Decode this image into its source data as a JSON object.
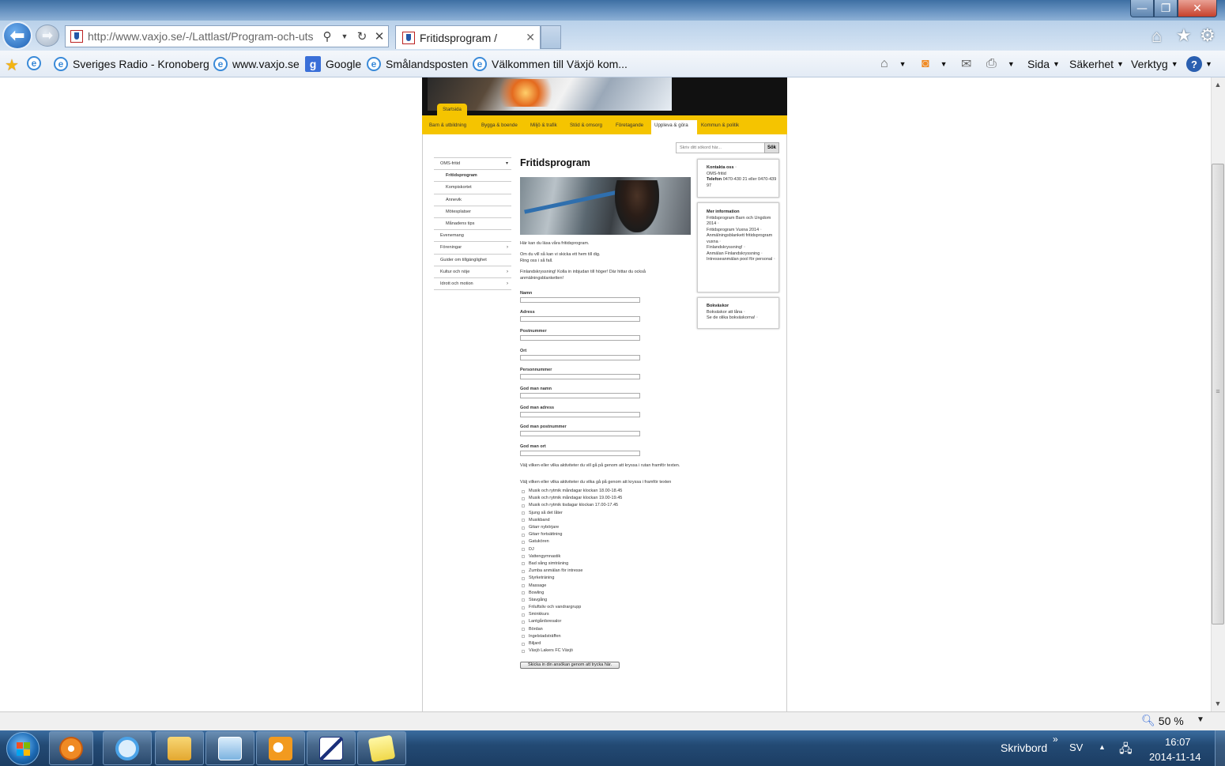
{
  "browser": {
    "window_controls": {
      "minimize": "—",
      "maximize": "❐",
      "close": "✕"
    },
    "address": "http://www.vaxjo.se/-/Lattlast/Program-och-uts",
    "tab_title": "Fritidsprogram /",
    "tab_close": "✕",
    "favorites": [
      {
        "label": "Sveriges Radio - Kronoberg",
        "icon": "ie-icon"
      },
      {
        "label": "www.vaxjo.se",
        "icon": "ie-icon"
      },
      {
        "label": "Google",
        "icon": "google-icon"
      },
      {
        "label": "Smålandsposten",
        "icon": "ie-icon"
      },
      {
        "label": "Välkommen till Växjö kom...",
        "icon": "ie-icon"
      }
    ],
    "google_letter": "g",
    "commands": {
      "page": "Sida",
      "safety": "Säkerhet",
      "tools": "Verktyg",
      "help": "?"
    },
    "zoom": "50 %"
  },
  "site": {
    "start_tab": "Startsida",
    "topnav": [
      "Barn & utbildning",
      "Bygga & boende",
      "Miljö & trafik",
      "Stöd & omsorg",
      "Företagande",
      "Uppleva & göra",
      "Kommun & politik"
    ],
    "search_placeholder": "Skriv ditt sökord här...",
    "search_button": "Sök",
    "leftmenu": [
      {
        "label": "OMS-fritid",
        "level": 0,
        "arrow": "▾"
      },
      {
        "label": "Fritidsprogram",
        "level": 1,
        "active": true
      },
      {
        "label": "Kompiskortet",
        "level": 1
      },
      {
        "label": "Annevik",
        "level": 1
      },
      {
        "label": "Mötesplatser",
        "level": 1
      },
      {
        "label": "Månadens tips",
        "level": 1
      },
      {
        "label": "Evenemang",
        "level": 0
      },
      {
        "label": "Föreningar",
        "level": 0,
        "arrow": "›"
      },
      {
        "label": "Guider om tillgänglighet",
        "level": 0
      },
      {
        "label": "Kultur och nöje",
        "level": 0,
        "arrow": "›"
      },
      {
        "label": "Idrott och motion",
        "level": 0,
        "arrow": "›"
      }
    ],
    "main": {
      "title": "Fritidsprogram",
      "intro": "Här kan du läsa våra fritidsprogram.",
      "send_line1": "Om du vill så kan vi skicka ett hem till dig.",
      "send_line2": "Ring oss i så fall.",
      "finland": "Finlandskryssning! Kolla in inbjudan till höger! Där hittar du också anmälningsblanketten!",
      "fields": [
        "Namn",
        "Adress",
        "Postnummer",
        "Ort",
        "Personnummer",
        "God man namn",
        "God man adress",
        "God man postnummer",
        "God man ort"
      ],
      "choose_text1": "Välj vilken eller vilka aktiviteter du vill gå på genom att kryssa i rutan framför texten.",
      "choose_text2": "Välj vilken eller vilka aktiviteter du vilka gå på genom att kryssa i framför texten",
      "activities": [
        "Musik och rytmik måndagar klockan 18.00-18.45",
        "Musik och rytmik måndagar klockan 19.00-19.45",
        "Musik och rytmik tisdagar klockan 17.00-17.45",
        "Sjung så det låter",
        "Musikband",
        "Gitarr nybörjare",
        "Gitarr fortsättning",
        "Gatukören",
        "DJ",
        "Vattengymnastik",
        "Bad sång simträning",
        "Zumba anmälan för intresse",
        "Styrketräning",
        "Massage",
        "Bowling",
        "Stavgång",
        "Friluftsliv och vandrargrupp",
        "Sminkkurs",
        "Lantgårdsresalor",
        "Bördan",
        "Ingelstadsträffen",
        "Biljard",
        "Växjö Lakers FC Växjö"
      ],
      "submit": "Skicka in din ansökan genom att trycka här."
    },
    "right": {
      "contact": {
        "title": "Kontakta oss",
        "line1": "OMS-fritid",
        "phone_label": "Telefon",
        "phone": "0470-430 21 eller 0470-439 97"
      },
      "more": {
        "title": "Mer information",
        "links": [
          "Fritidsprogram Barn och Ungdom 2014",
          "Fritidsprogram Vuxna 2014",
          "Anmälningsblankett fritidsprogram vuxna",
          "Finlandskryssning!",
          "Anmälan Finlandskryssning",
          "Intresseanmälan pool för personal"
        ]
      },
      "books": {
        "title": "Bokväskor",
        "links": [
          "Bokväskor att låna",
          "Se de olika bokväskorna!"
        ]
      }
    }
  },
  "taskbar": {
    "desktop_label": "Skrivbord",
    "chevron": "»",
    "lang": "SV",
    "time": "16:07",
    "date": "2014-11-14"
  }
}
